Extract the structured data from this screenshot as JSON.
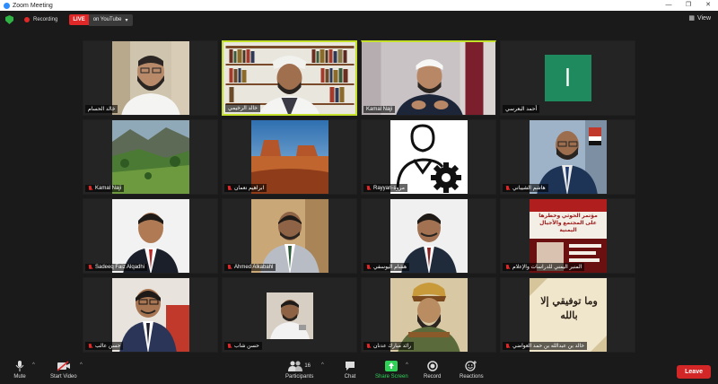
{
  "window": {
    "title": "Zoom Meeting",
    "controls": [
      "—",
      "❐",
      "✕"
    ]
  },
  "status": {
    "recording_label": "Recording",
    "live_label": "LIVE",
    "stream_label": "on YouTube",
    "view_label": "View"
  },
  "participants": [
    {
      "name": "خالد الحسام",
      "muted": false,
      "video": "man-beard-light"
    },
    {
      "name": "خالد الرخيمي",
      "muted": false,
      "video": "man-turban-books",
      "active": true
    },
    {
      "name": "Kamal Naji",
      "muted": false,
      "video": "man-cap-dark",
      "speaker": true
    },
    {
      "name": "أحمد البعرسي",
      "muted": false,
      "initial": "ا"
    },
    {
      "name": "Kamal Naji",
      "muted": true,
      "video": "landscape-green"
    },
    {
      "name": "ابراهيم نعمان",
      "muted": true,
      "video": "landscape-desert"
    },
    {
      "name": "Rayyan-مروة",
      "muted": true,
      "video": "user-gear-icon"
    },
    {
      "name": "هاشم الشيباني",
      "muted": true,
      "video": "man-suit-flag"
    },
    {
      "name": "Sadeeq Faiz Alqadhi",
      "muted": true,
      "video": "man-suit-white"
    },
    {
      "name": "Ahmed Alkabahl",
      "muted": true,
      "video": "man-suit-wall"
    },
    {
      "name": "هشام اليوسفي",
      "muted": true,
      "video": "man-suit-white2"
    },
    {
      "name": "المنبر اليمني للدراسات والإعلام",
      "muted": true,
      "video": "poster-red",
      "poster_title": "مؤتمر الحوثي وخطرها على المجتمع والأجيال اليمنية"
    },
    {
      "name": "حسن عالب",
      "muted": true,
      "video": "man-suit-glasses"
    },
    {
      "name": "حسن شاب",
      "muted": true,
      "video": "man-small-frame"
    },
    {
      "name": "رائد مبارك عدنان",
      "muted": true,
      "video": "painting-warrior"
    },
    {
      "name": "خالد بن عبدالله بن حمد العواضي",
      "muted": true,
      "video": "calligraphy",
      "calligraphy_text": "وما توفيقي إلا بالله"
    }
  ],
  "toolbar": {
    "mute": "Mute",
    "start_video": "Start Video",
    "participants": "Participants",
    "participants_count": "16",
    "chat": "Chat",
    "share_screen": "Share Screen",
    "record": "Record",
    "reactions": "Reactions",
    "leave": "Leave"
  },
  "colors": {
    "accent_active": "#c4e02b",
    "live_red": "#e02828",
    "leave_red": "#d32626",
    "share_green": "#2fd157",
    "secure_green": "#2fb344",
    "initial_bg": "#1f8a5e"
  }
}
